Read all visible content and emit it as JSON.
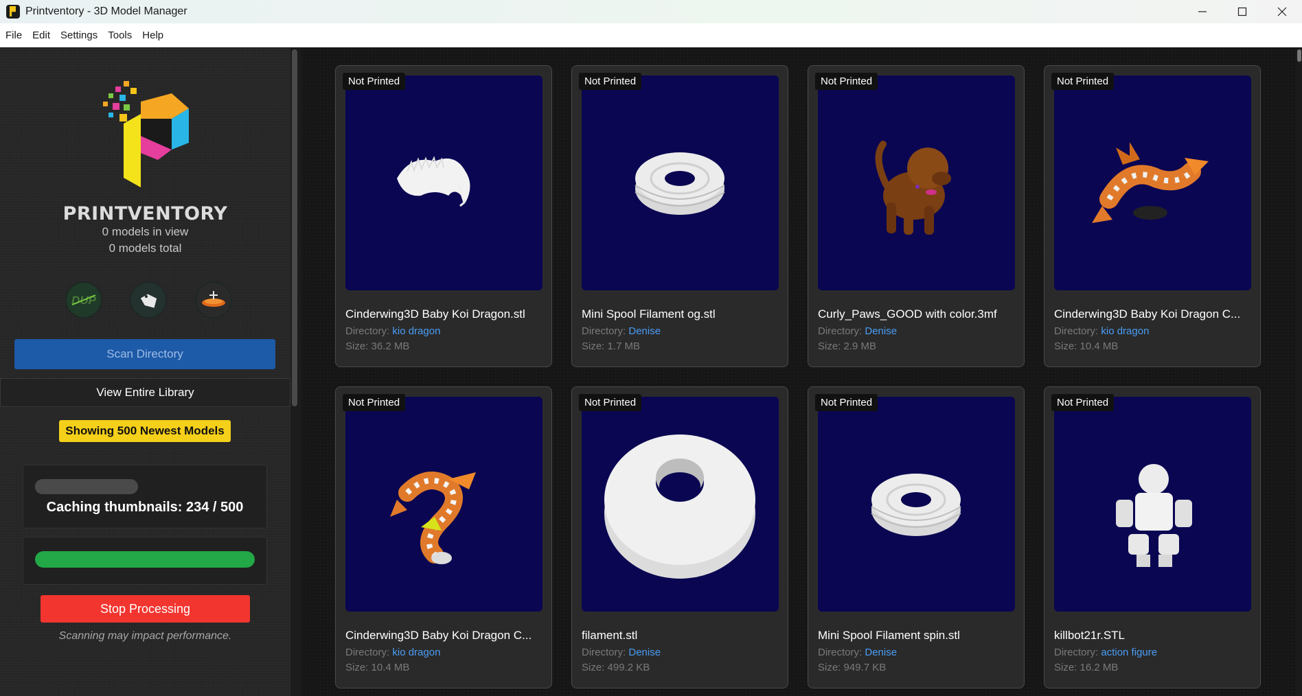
{
  "window": {
    "title": "Printventory - 3D Model Manager"
  },
  "menu": [
    "File",
    "Edit",
    "Settings",
    "Tools",
    "Help"
  ],
  "sidebar": {
    "brand": "PRINTVENTORY",
    "models_in_view": "0 models in view",
    "models_total": "0 models total",
    "icon_buttons": [
      {
        "name": "duplicates-icon",
        "text": "DUP"
      },
      {
        "name": "tag-icon"
      },
      {
        "name": "printer-bed-icon"
      }
    ],
    "scan_label": "Scan Directory",
    "view_library_label": "View Entire Library",
    "showing_label": "Showing 500 Newest Models",
    "caching_text": "Caching thumbnails: 234 / 500",
    "caching_progress": 0.468,
    "overall_progress": 1.0,
    "stop_label": "Stop Processing",
    "note": "Scanning may impact performance."
  },
  "colors": {
    "scan_button": "#1d5aa8",
    "showing_badge": "#f5d01a",
    "progress_green": "#22a847",
    "stop_button": "#f2352f",
    "thumbnail_bg": "#0a0652",
    "link": "#4a9df5"
  },
  "models": [
    {
      "status": "Not Printed",
      "title": "Cinderwing3D Baby Koi Dragon.stl",
      "dir_label": "Directory:",
      "dir": "kio dragon",
      "size": "Size: 36.2 MB",
      "thumb": "white-dragon"
    },
    {
      "status": "Not Printed",
      "title": "Mini Spool Filament og.stl",
      "dir_label": "Directory:",
      "dir": "Denise",
      "size": "Size: 1.7 MB",
      "thumb": "spool"
    },
    {
      "status": "Not Printed",
      "title": "Curly_Paws_GOOD with color.3mf",
      "dir_label": "Directory:",
      "dir": "Denise",
      "size": "Size: 2.9 MB",
      "thumb": "dog"
    },
    {
      "status": "Not Printed",
      "title": "Cinderwing3D Baby Koi Dragon C...",
      "dir_label": "Directory:",
      "dir": "kio dragon",
      "size": "Size: 10.4 MB",
      "thumb": "koi-dragon"
    },
    {
      "status": "Not Printed",
      "title": "Cinderwing3D Baby Koi Dragon C...",
      "dir_label": "Directory:",
      "dir": "kio dragon",
      "size": "Size: 10.4 MB",
      "thumb": "koi-dragon-2"
    },
    {
      "status": "Not Printed",
      "title": "filament.stl",
      "dir_label": "Directory:",
      "dir": "Denise",
      "size": "Size: 499.2 KB",
      "thumb": "big-spool"
    },
    {
      "status": "Not Printed",
      "title": "Mini Spool Filament spin.stl",
      "dir_label": "Directory:",
      "dir": "Denise",
      "size": "Size: 949.7 KB",
      "thumb": "spool"
    },
    {
      "status": "Not Printed",
      "title": "killbot21r.STL",
      "dir_label": "Directory:",
      "dir": "action figure",
      "size": "Size: 16.2 MB",
      "thumb": "robot"
    }
  ]
}
